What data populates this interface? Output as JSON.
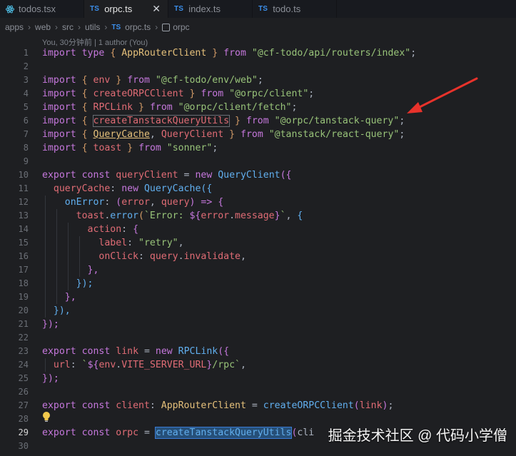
{
  "tabs": [
    {
      "label": "todos.tsx",
      "kind": "tsx"
    },
    {
      "label": "orpc.ts",
      "kind": "ts",
      "badge": "TS",
      "active": true
    },
    {
      "label": "index.ts",
      "kind": "ts",
      "badge": "TS"
    },
    {
      "label": "todo.ts",
      "kind": "ts",
      "badge": "TS"
    }
  ],
  "breadcrumb": [
    "apps",
    "web",
    "src",
    "utils",
    "orpc.ts",
    "orpc"
  ],
  "breadcrumb_ts_badge": "TS",
  "codelens": "You, 30分钟前 | 1 author (You)",
  "watermark": "掘金技术社区 @ 代码小学僧",
  "line_numbers": [
    "1",
    "2",
    "3",
    "4",
    "5",
    "6",
    "7",
    "8",
    "9",
    "10",
    "11",
    "12",
    "13",
    "14",
    "15",
    "16",
    "17",
    "18",
    "19",
    "20",
    "21",
    "22",
    "23",
    "24",
    "25",
    "26",
    "27",
    "28",
    "29",
    "30"
  ],
  "current_line": "29",
  "code": {
    "l1": {
      "k1": "import",
      "k2": "type",
      "p1": "{",
      "id": "AppRouterClient",
      "p2": "}",
      "k3": "from",
      "s": "\"@cf-todo/api/routers/index\"",
      "e": ";"
    },
    "l3": {
      "k1": "import",
      "p1": "{",
      "id": "env",
      "p2": "}",
      "k3": "from",
      "s": "\"@cf-todo/env/web\"",
      "e": ";"
    },
    "l4": {
      "k1": "import",
      "p1": "{",
      "id": "createORPCClient",
      "p2": "}",
      "k3": "from",
      "s": "\"@orpc/client\"",
      "e": ";"
    },
    "l5": {
      "k1": "import",
      "p1": "{",
      "id": "RPCLink",
      "p2": "}",
      "k3": "from",
      "s": "\"@orpc/client/fetch\"",
      "e": ";"
    },
    "l6": {
      "k1": "import",
      "p1": "{",
      "id": "createTanstackQueryUtils",
      "p2": "}",
      "k3": "from",
      "s": "\"@orpc/tanstack-query\"",
      "e": ";"
    },
    "l7": {
      "k1": "import",
      "p1": "{",
      "id1": "QueryCache",
      "c": ",",
      "id2": "QueryClient",
      "p2": "}",
      "k3": "from",
      "s": "\"@tanstack/react-query\"",
      "e": ";"
    },
    "l8": {
      "k1": "import",
      "p1": "{",
      "id": "toast",
      "p2": "}",
      "k3": "from",
      "s": "\"sonner\"",
      "e": ";"
    },
    "l10": {
      "k1": "export",
      "k2": "const",
      "v": "queryClient",
      "eq": "=",
      "k3": "new",
      "f": "QueryClient",
      "b": "({"
    },
    "l11": {
      "p": "queryCache",
      "c": ":",
      "k": "new",
      "f": "QueryCache",
      "b": "({"
    },
    "l12": {
      "p": "onError",
      "c": ":",
      "b1": "(",
      "a1": "error",
      "cm": ",",
      "a2": "query",
      "b2": ")",
      "ar": "=>",
      "b3": "{"
    },
    "l13": {
      "o": "toast",
      "d": ".",
      "f": "error",
      "b": "(",
      "t1": "`Error: ",
      "t2": "${",
      "v": "error",
      "d2": ".",
      "pp": "message",
      "t3": "}",
      "t4": "`",
      "cm": ",",
      "b2": "{"
    },
    "l14": {
      "p": "action",
      "c": ":",
      "b": "{"
    },
    "l15": {
      "p": "label",
      "c": ":",
      "s": "\"retry\"",
      "cm": ","
    },
    "l16": {
      "p": "onClick",
      "c": ":",
      "o": "query",
      "d": ".",
      "pp": "invalidate",
      "cm": ","
    },
    "l17": {
      "b": "},"
    },
    "l18": {
      "b": "});"
    },
    "l19": {
      "b": "},"
    },
    "l20": {
      "b": "}),"
    },
    "l21": {
      "b": "});"
    },
    "l23": {
      "k1": "export",
      "k2": "const",
      "v": "link",
      "eq": "=",
      "k3": "new",
      "f": "RPCLink",
      "b": "({"
    },
    "l24": {
      "p": "url",
      "c": ":",
      "t1": "`",
      "t2": "${",
      "o": "env",
      "d": ".",
      "pp": "VITE_SERVER_URL",
      "t3": "}",
      "t4": "/rpc`",
      "cm": ","
    },
    "l25": {
      "b": "});"
    },
    "l27": {
      "k1": "export",
      "k2": "const",
      "v": "client",
      "c": ":",
      "ty": "AppRouterClient",
      "eq": "=",
      "f": "createORPCClient",
      "b1": "(",
      "a": "link",
      "b2": ")",
      "e": ";"
    },
    "l29": {
      "k1": "export",
      "k2": "const",
      "v": "orpc",
      "eq": "=",
      "f": "createTanstackQueryUtils",
      "b1": "(",
      "a": "cli"
    }
  }
}
